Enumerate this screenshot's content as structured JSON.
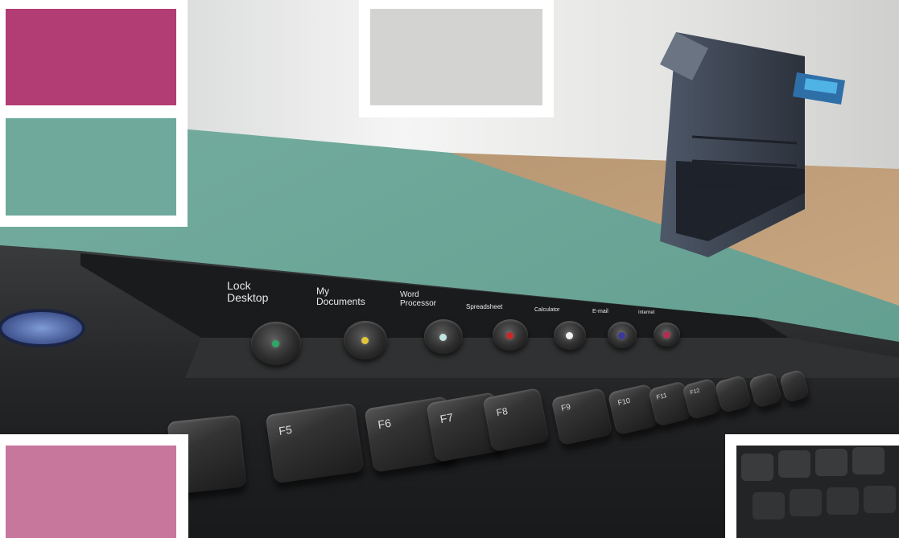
{
  "colors": {
    "magenta_tile": "#b23c74",
    "teal_tile": "#6ea99c",
    "pink_tile": "#c7769c",
    "grey_tile": "#d3d4d2",
    "teal_desk": "#6aa899",
    "keyboard_body": "#262728"
  },
  "keyboard": {
    "hotkeys": [
      {
        "label": "Lock\nDesktop",
        "led": "#2fa667"
      },
      {
        "label": "My\nDocuments",
        "led": "#e2c53a"
      },
      {
        "label": "Word\nProcessor",
        "led": "#bfe6e3"
      },
      {
        "label": "Spreadsheet",
        "led": "#c62a2a"
      },
      {
        "label": "Calculator",
        "led": "#f2f2f2"
      },
      {
        "label": "E-mail",
        "led": "#3a3a9a"
      },
      {
        "label": "Internet",
        "led": "#b03050"
      }
    ],
    "function_keys": [
      "F5",
      "F6",
      "F7",
      "F8",
      "F9",
      "F10",
      "F11",
      "F12"
    ]
  }
}
